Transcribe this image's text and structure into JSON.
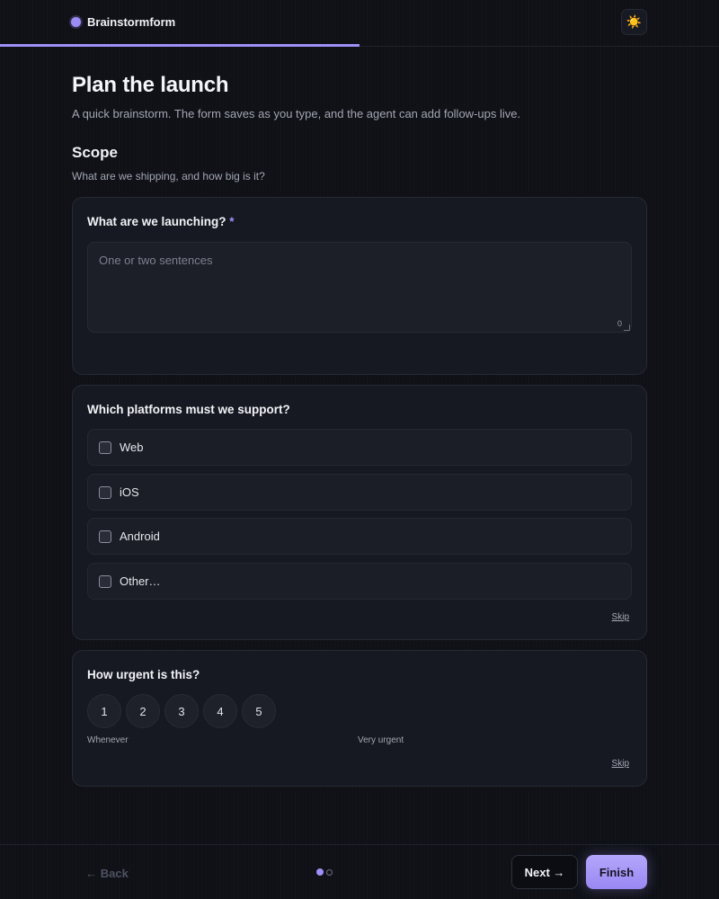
{
  "app": {
    "name": "Brainstormform",
    "theme_icon": "sun-icon"
  },
  "progress": {
    "fraction": 0.5
  },
  "page": {
    "title": "Plan the launch",
    "subtitle": "A quick brainstorm. The form saves as you type, and the agent can add follow-ups live."
  },
  "section": {
    "title": "Scope",
    "subtitle": "What are we shipping, and how big is it?"
  },
  "q1": {
    "label": "What are we launching?",
    "required_mark": "*",
    "placeholder": "One or two sentences",
    "value": "",
    "char_count": "0"
  },
  "q2": {
    "label": "Which platforms must we support?",
    "options": [
      "Web",
      "iOS",
      "Android",
      "Other…"
    ],
    "skip": "Skip"
  },
  "q3": {
    "label": "How urgent is this?",
    "scale": [
      "1",
      "2",
      "3",
      "4",
      "5"
    ],
    "min_label": "Whenever",
    "max_label": "Very urgent",
    "skip": "Skip"
  },
  "footer": {
    "back": "← Back",
    "next": "Next →",
    "finish": "Finish",
    "steps_total": 2,
    "steps_current": 1
  },
  "colors": {
    "accent": "#a08ff7",
    "background": "#0f1117",
    "card": "#161921"
  }
}
